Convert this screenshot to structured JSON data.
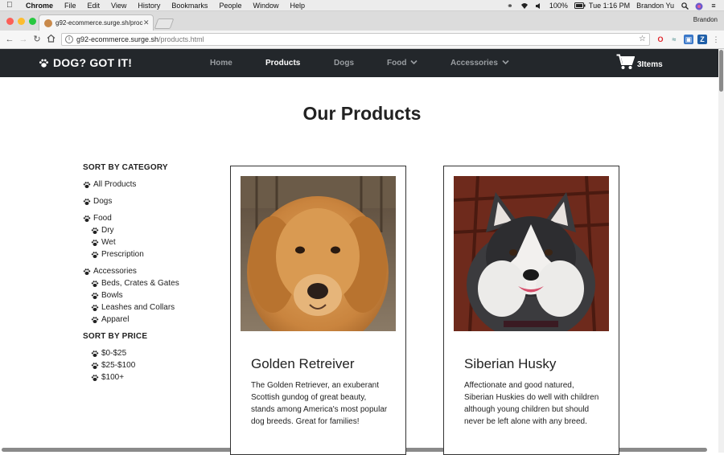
{
  "menubar": {
    "app_name": "Chrome",
    "items": [
      "File",
      "Edit",
      "View",
      "History",
      "Bookmarks",
      "People",
      "Window",
      "Help"
    ],
    "battery": "100%",
    "clock": "Tue 1:16 PM",
    "user": "Brandon Yu"
  },
  "browser": {
    "tab_title": "g92-ecommerce.surge.sh/proc",
    "profile_name": "Brandon",
    "url_host": "g92-ecommerce.surge.sh",
    "url_path": "/products.html"
  },
  "site": {
    "brand": "DOG? GOT IT!",
    "nav": [
      {
        "label": "Home"
      },
      {
        "label": "Products"
      },
      {
        "label": "Dogs"
      },
      {
        "label": "Food"
      },
      {
        "label": "Accessories"
      }
    ],
    "cart_label": "3Items"
  },
  "page": {
    "title_bold": "Our",
    "title_rest": "Products"
  },
  "sidebar": {
    "category_heading": "SORT BY CATEGORY",
    "categories": {
      "all": "All Products",
      "dogs": "Dogs",
      "food": "Food",
      "food_sub": [
        "Dry",
        "Wet",
        "Prescription"
      ],
      "accessories": "Accessories",
      "accessories_sub": [
        "Beds, Crates & Gates",
        "Bowls",
        "Leashes and Collars",
        "Apparel"
      ]
    },
    "price_heading": "SORT BY PRICE",
    "prices": [
      "$0-$25",
      "$25-$100",
      "$100+"
    ]
  },
  "products": [
    {
      "name": "Golden Retreiver",
      "description": "The Golden Retriever, an exuberant Scottish gundog of great beauty, stands among America's most popular dog breeds. Great for families!"
    },
    {
      "name": "Siberian Husky",
      "description": "Affectionate and good natured, Siberian Huskies do well with children although young children but should never be left alone with any breed."
    }
  ],
  "colors": {
    "navbar_bg": "#23272b",
    "nav_inactive": "#9a9ea2",
    "card_border": "#333333"
  }
}
